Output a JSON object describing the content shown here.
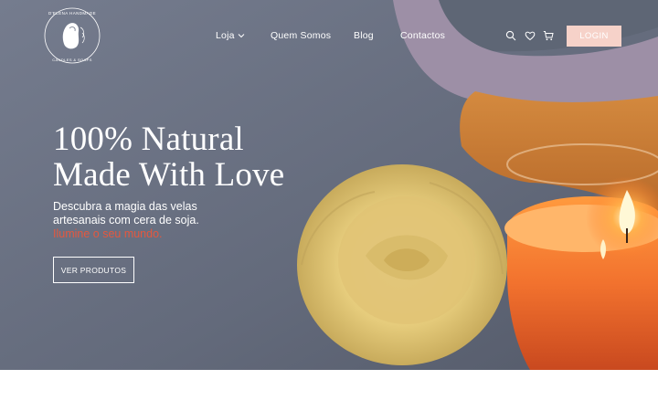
{
  "brand": {
    "logo_text_top": "D'ELENA HANDMADE",
    "logo_text_bottom": "CANDLES & SOAPS"
  },
  "nav": {
    "items": [
      {
        "label": "Loja",
        "has_dropdown": true
      },
      {
        "label": "Quem Somos",
        "has_dropdown": false
      },
      {
        "label": "Blog",
        "has_dropdown": false
      },
      {
        "label": "Contactos",
        "has_dropdown": false
      }
    ],
    "icons": [
      "search-icon",
      "heart-icon",
      "cart-icon"
    ],
    "login_label": "LOGIN"
  },
  "hero": {
    "headline_line1": "100% Natural",
    "headline_line2": "Made With Love",
    "sub_line1": "Descubra a magia das velas",
    "sub_line2": "artesanais com cera de soja.",
    "sub_line3": "Ilumine o seu mundo.",
    "cta_label": "VER PRODUTOS"
  },
  "colors": {
    "accent": "#e4583f",
    "login_bg": "#f6d2c9",
    "text": "#ffffff"
  }
}
